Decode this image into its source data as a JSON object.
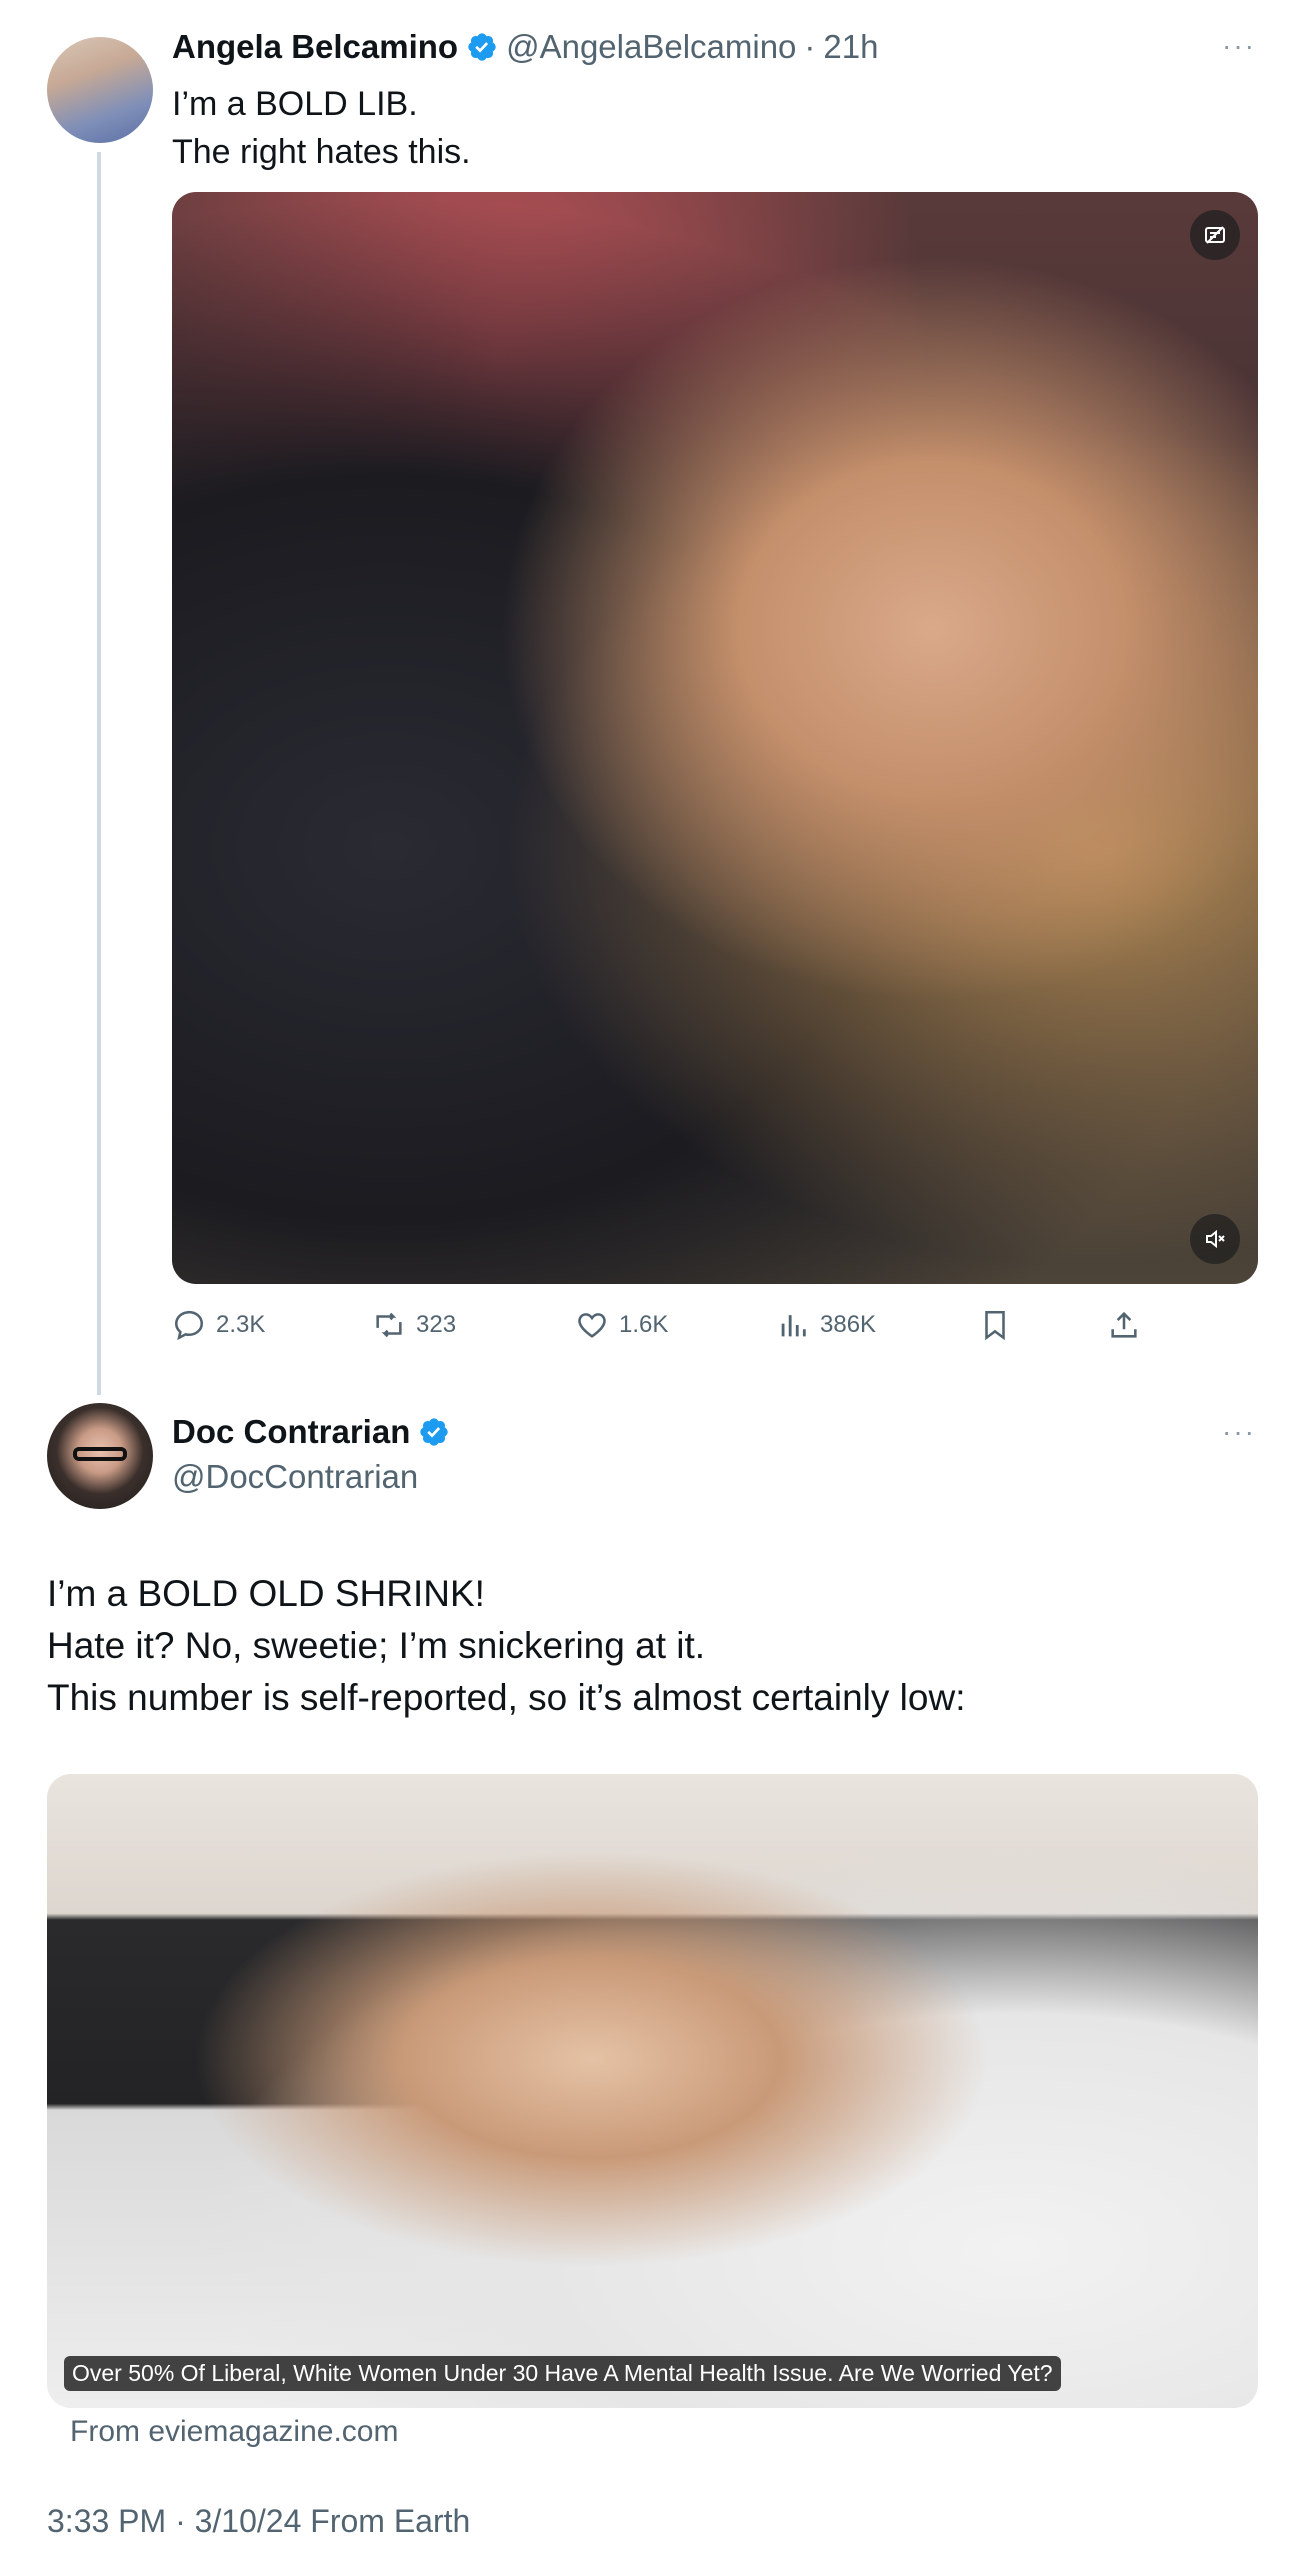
{
  "tweet1": {
    "name": "Angela Belcamino",
    "handle": "@AngelaBelcamino",
    "separator": "·",
    "time": "21h",
    "more": "···",
    "lines": [
      "I’m a BOLD LIB.",
      "The right hates this."
    ],
    "actions": {
      "replies": "2.3K",
      "reposts": "323",
      "likes": "1.6K",
      "views": "386K"
    }
  },
  "tweet2": {
    "name": "Doc Contrarian",
    "handle": "@DocContrarian",
    "more": "···",
    "lines": [
      "I’m a BOLD OLD SHRINK!",
      "Hate it? No, sweetie; I’m snickering at it.",
      "This number is self-reported, so it’s almost certainly low:"
    ],
    "card": {
      "caption": "Over 50% Of Liberal, White Women Under 30 Have A Mental Health Issue. Are We Worried Yet?",
      "source": "From eviemagazine.com"
    },
    "timestamp": "3:33 PM · 3/10/24 From Earth"
  },
  "colors": {
    "verified": "#1d9bf0",
    "muted_text": "#536471",
    "thread_line": "#cfd9de"
  },
  "icons": [
    "verified-icon",
    "more-icon",
    "reply-icon",
    "repost-icon",
    "like-icon",
    "views-icon",
    "bookmark-icon",
    "share-icon",
    "media-options-icon",
    "mute-icon"
  ]
}
